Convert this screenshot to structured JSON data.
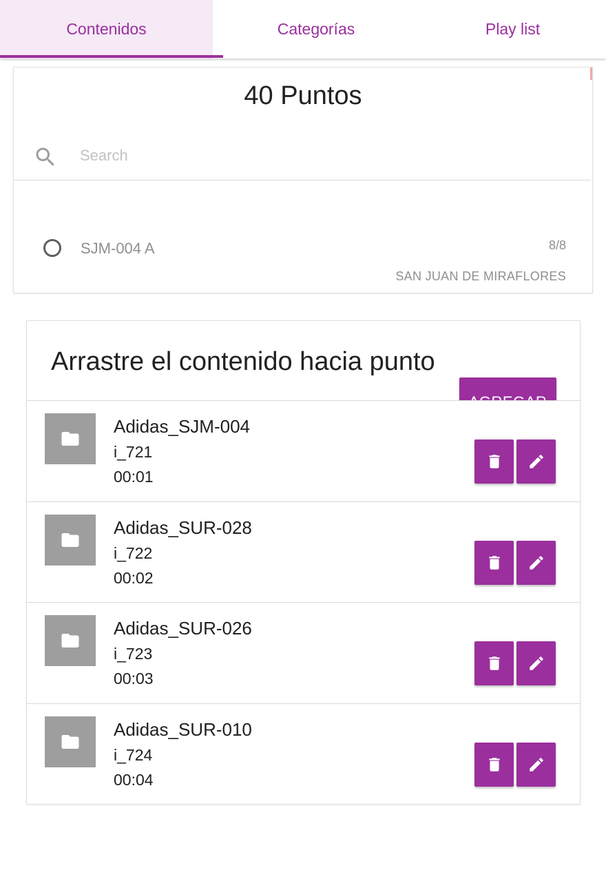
{
  "tabs": [
    {
      "label": "Contenidos",
      "active": true
    },
    {
      "label": "Categorías",
      "active": false
    },
    {
      "label": "Play list",
      "active": false
    }
  ],
  "points": {
    "title": "40 Puntos",
    "search_placeholder": "Search",
    "search_value": "",
    "items": [
      {
        "name": "SJM-004 A",
        "count": "8/8",
        "district": "SAN JUAN DE MIRAFLORES",
        "selected": false
      }
    ]
  },
  "content": {
    "title": "Arrastre el contenido hacia punto",
    "add_label": "AGREGAR",
    "items": [
      {
        "name": "Adidas_SJM-004",
        "id": "i_721",
        "duration": "00:01"
      },
      {
        "name": "Adidas_SUR-028",
        "id": "i_722",
        "duration": "00:02"
      },
      {
        "name": "Adidas_SUR-026",
        "id": "i_723",
        "duration": "00:03"
      },
      {
        "name": "Adidas_SUR-010",
        "id": "i_724",
        "duration": "00:04"
      }
    ],
    "icons": {
      "thumbnail": "folder-icon",
      "delete": "trash-icon",
      "edit": "pencil-icon"
    }
  },
  "colors": {
    "accent": "#9b2f9e",
    "active_tab_bg": "#f5eaf6",
    "thumb_bg": "#9e9e9e"
  }
}
